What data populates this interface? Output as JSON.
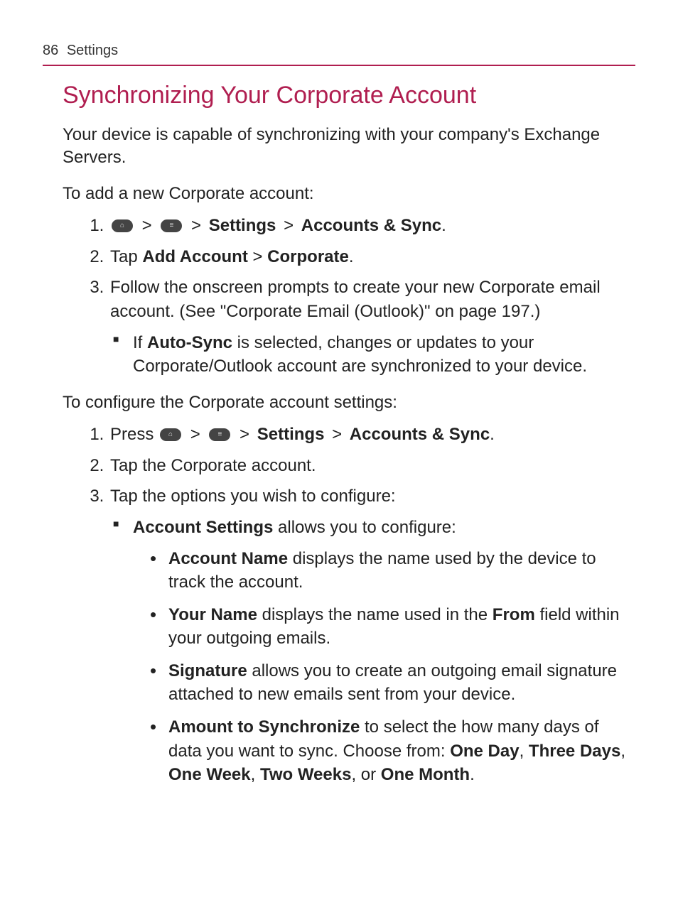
{
  "header": {
    "page_number": "86",
    "section": "Settings"
  },
  "title": "Synchronizing Your Corporate Account",
  "intro": "Your device is capable of synchronizing with your company's Exchange Servers.",
  "add": {
    "heading": "To add a new Corporate account:",
    "step1": {
      "settings": "Settings",
      "accounts_sync": "Accounts & Sync",
      "period": "."
    },
    "step2": {
      "tap": "Tap ",
      "add_account": "Add Account",
      "gt": " > ",
      "corporate": "Corporate",
      "period": "."
    },
    "step3": "Follow the onscreen prompts to create your new Corporate email account. (See \"Corporate Email (Outlook)\" on page 197.)",
    "step3_sub": {
      "pre": "If ",
      "autosync": "Auto-Sync",
      "post": " is selected, changes or updates to your Corporate/Outlook account are synchronized to your device."
    }
  },
  "configure": {
    "heading": "To configure the Corporate account settings:",
    "step1": {
      "press": "Press ",
      "settings": "Settings",
      "accounts_sync": "Accounts & Sync",
      "period": "."
    },
    "step2": "Tap the Corporate account.",
    "step3": "Tap the options you wish to configure:",
    "acct_settings": {
      "label": "Account Settings",
      "post": " allows you to configure:"
    },
    "items": {
      "acct_name": {
        "label": "Account Name",
        "post": " displays the name used by the device to track the account."
      },
      "your_name": {
        "label": "Your Name",
        "mid": " displays the name used in the ",
        "from": "From",
        "post": " field within your outgoing emails."
      },
      "signature": {
        "label": "Signature",
        "post": " allows you to create an outgoing email signature attached to new emails sent from your device."
      },
      "amount": {
        "label": "Amount to Synchronize",
        "mid": " to select the how many days of data you want to sync. Choose from: ",
        "o1": "One Day",
        "c1": ", ",
        "o2": "Three Days",
        "c2": ", ",
        "o3": "One Week",
        "c3": ", ",
        "o4": "Two Weeks",
        "c4": ", or ",
        "o5": "One Month",
        "end": "."
      }
    }
  },
  "glyphs": {
    "gt": ">"
  }
}
